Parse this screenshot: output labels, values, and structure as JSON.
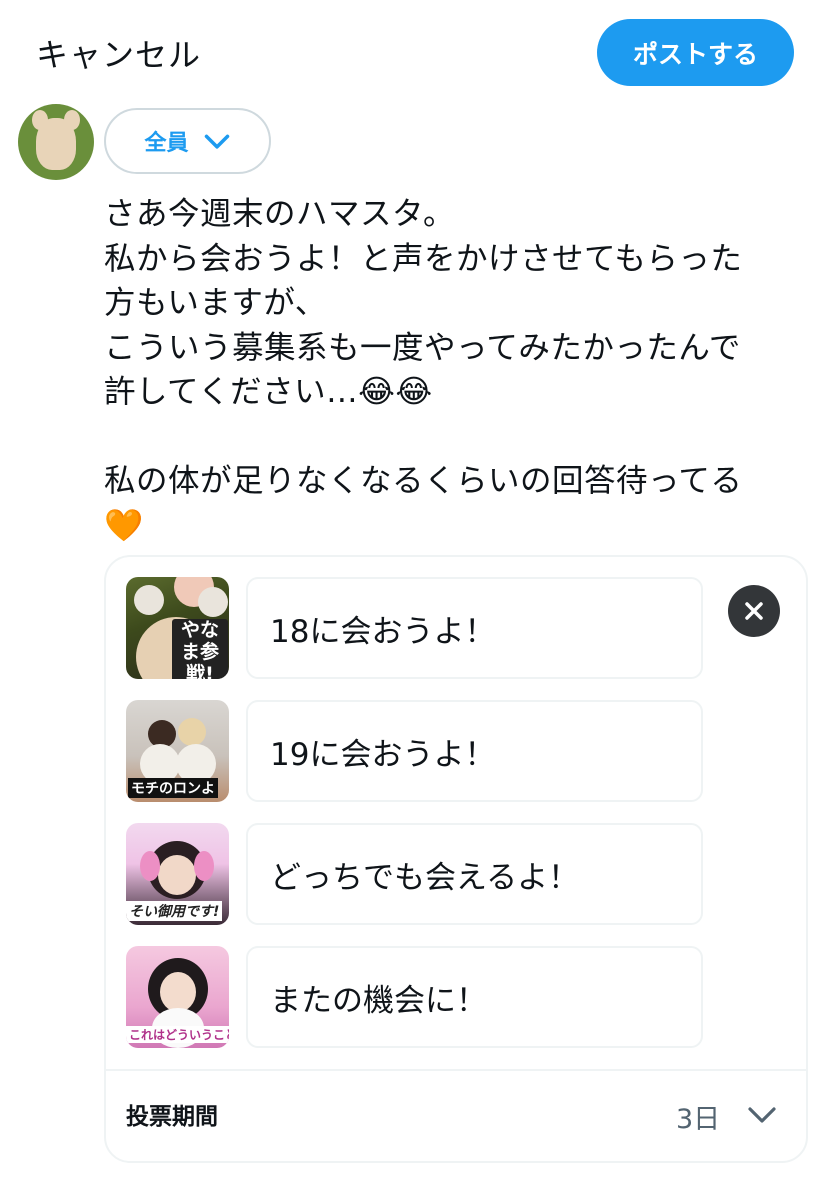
{
  "header": {
    "cancel_label": "キャンセル",
    "post_label": "ポストする"
  },
  "composer": {
    "audience_label": "全員",
    "lines": [
      "さあ今週末のハマスタ。",
      "私から会おうよ！と声をかけさせてもらった",
      "方もいますが、",
      "こういう募集系も一度やってみたかったんで",
      "許してください…😂😂",
      "",
      "私の体が足りなくなるくらいの回答待ってる",
      "🧡"
    ]
  },
  "poll": {
    "options": [
      {
        "text": "18に会おうよ！",
        "thumb_caption": "やなま参戦!"
      },
      {
        "text": "19に会おうよ！",
        "thumb_caption": "モチのロンよ"
      },
      {
        "text": "どっちでも会えるよ！",
        "thumb_caption": "そい御用です!"
      },
      {
        "text": "またの機会に！",
        "thumb_caption": "これはどういうこと"
      }
    ],
    "duration_label": "投票期間",
    "duration_value": "3日"
  },
  "colors": {
    "accent": "#1d9bf0",
    "text": "#0f1419",
    "muted": "#536471",
    "border": "#eff3f4"
  }
}
